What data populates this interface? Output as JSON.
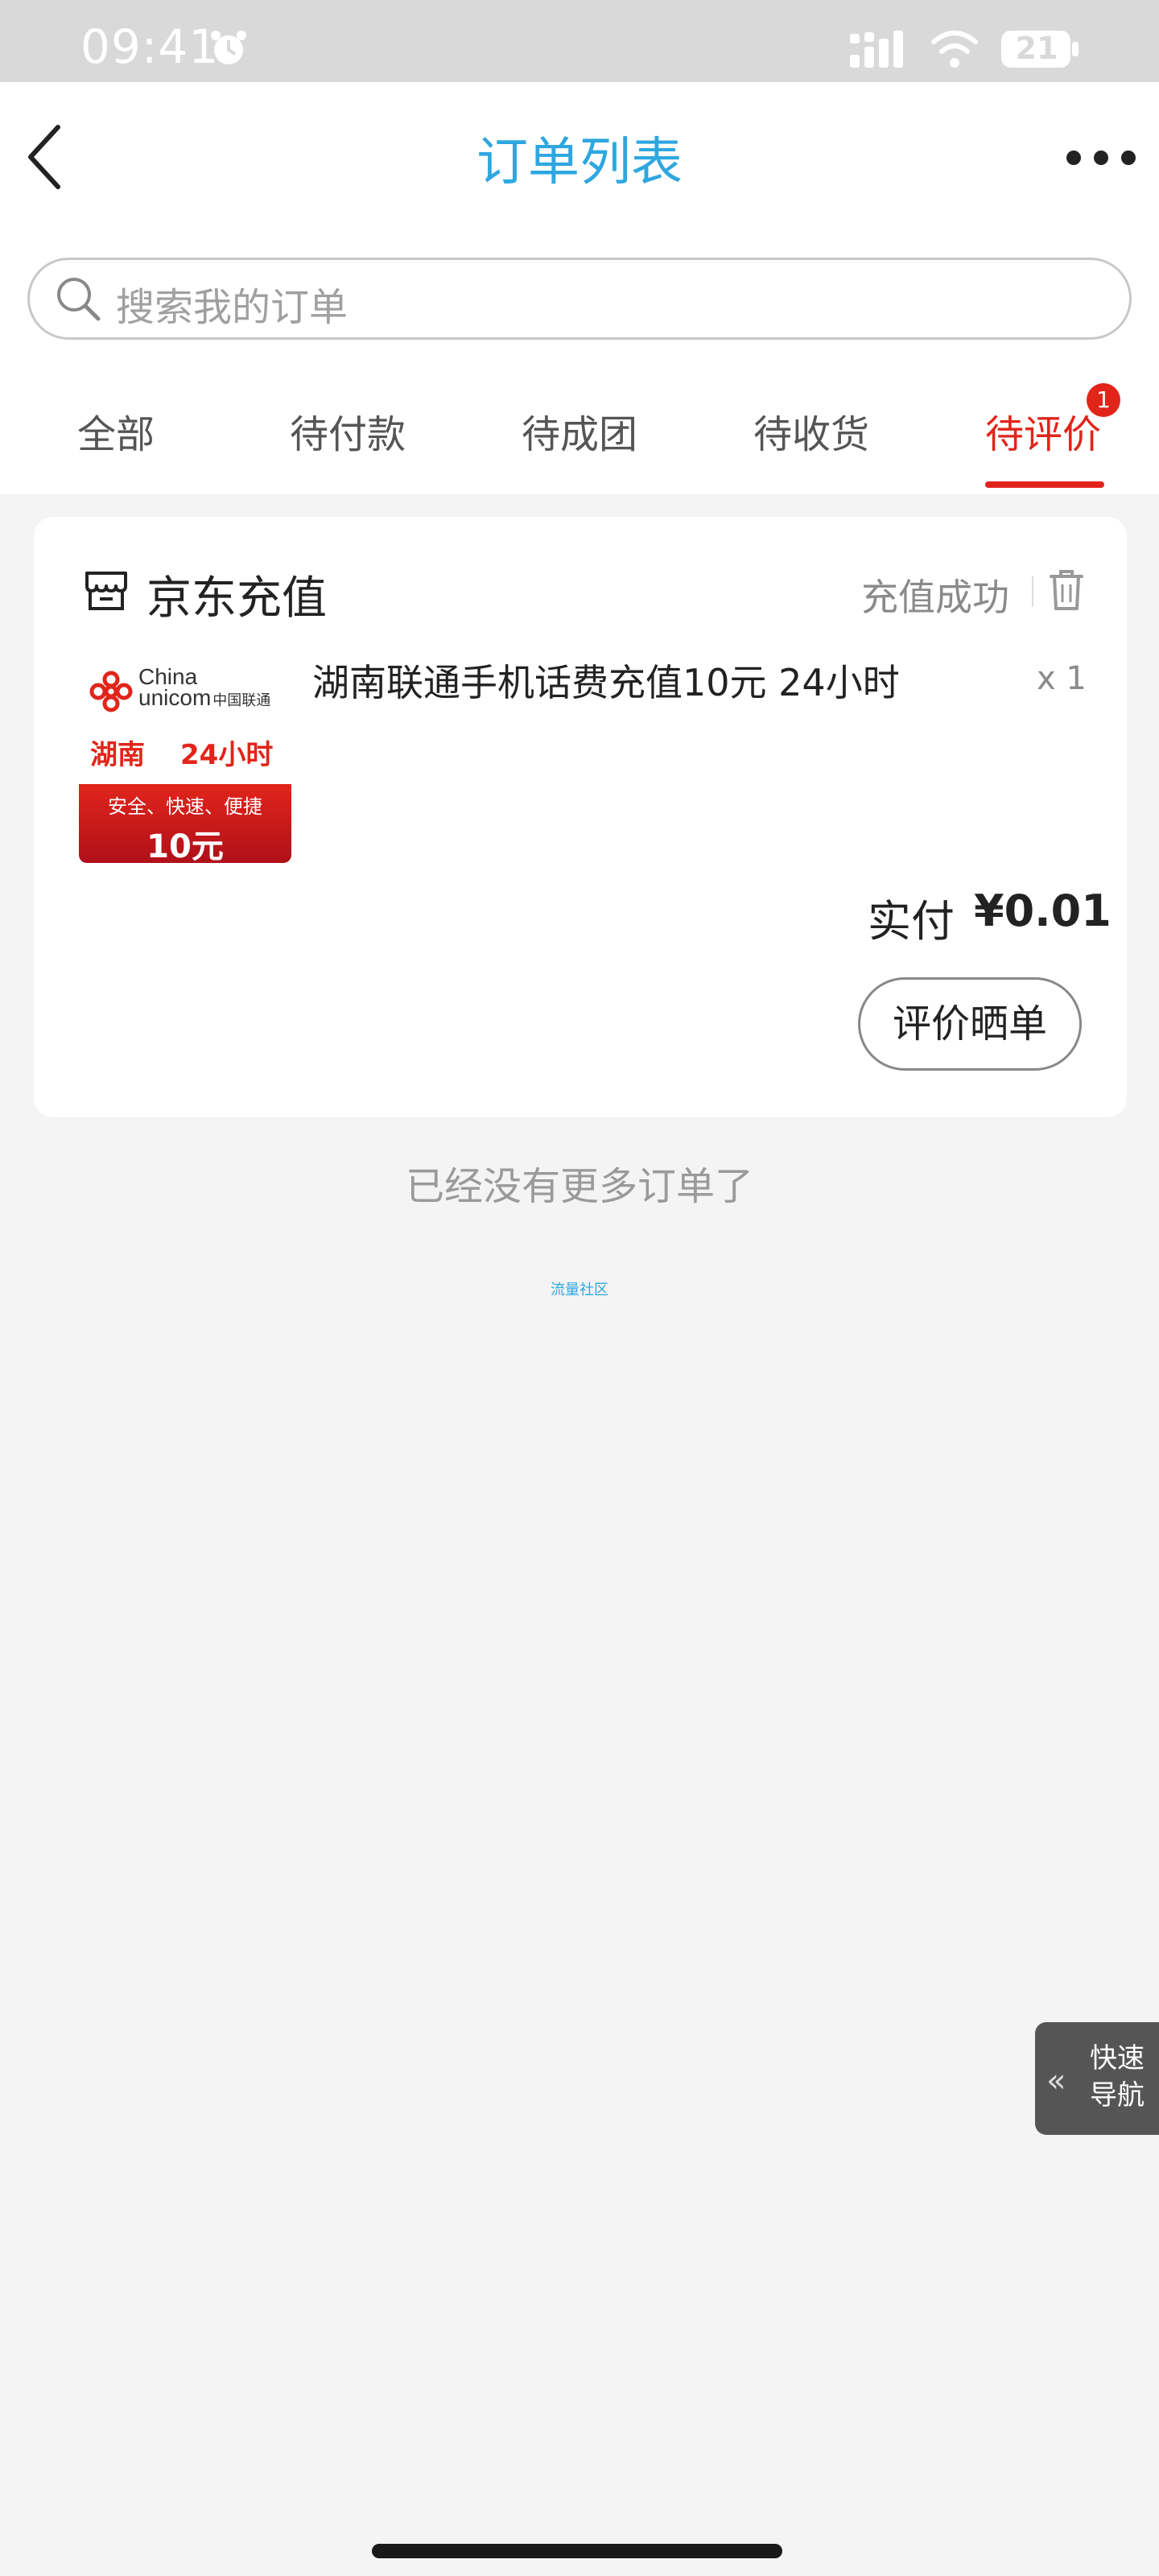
{
  "status_bar": {
    "time": "09:41",
    "battery": "21"
  },
  "header": {
    "title": "订单列表"
  },
  "search": {
    "placeholder": "搜索我的订单"
  },
  "tabs": [
    {
      "label": "全部"
    },
    {
      "label": "待付款"
    },
    {
      "label": "待成团"
    },
    {
      "label": "待收货"
    },
    {
      "label": "待评价",
      "badge": "1",
      "active": true
    }
  ],
  "order": {
    "store_name": "京东充值",
    "status": "充值成功",
    "product_name": "湖南联通手机话费充值10元 24小时",
    "quantity": "x 1",
    "thumbnail": {
      "brand_en_1": "China",
      "brand_en_2": "unicom",
      "brand_cn": "中国联通",
      "region": "湖南",
      "hours": "24小时",
      "slogan": "安全、快速、便捷",
      "amount": "10元"
    },
    "paid_label": "实付",
    "paid_amount": "¥0.01",
    "review_button": "评价晒单"
  },
  "footer": {
    "no_more": "已经没有更多订单了",
    "community": "流量社区"
  },
  "quick_nav": {
    "arrows": "«",
    "label_line1": "快速",
    "label_line2": "导航"
  },
  "colors": {
    "accent": "#e1251b",
    "title": "#2ea7e0"
  }
}
